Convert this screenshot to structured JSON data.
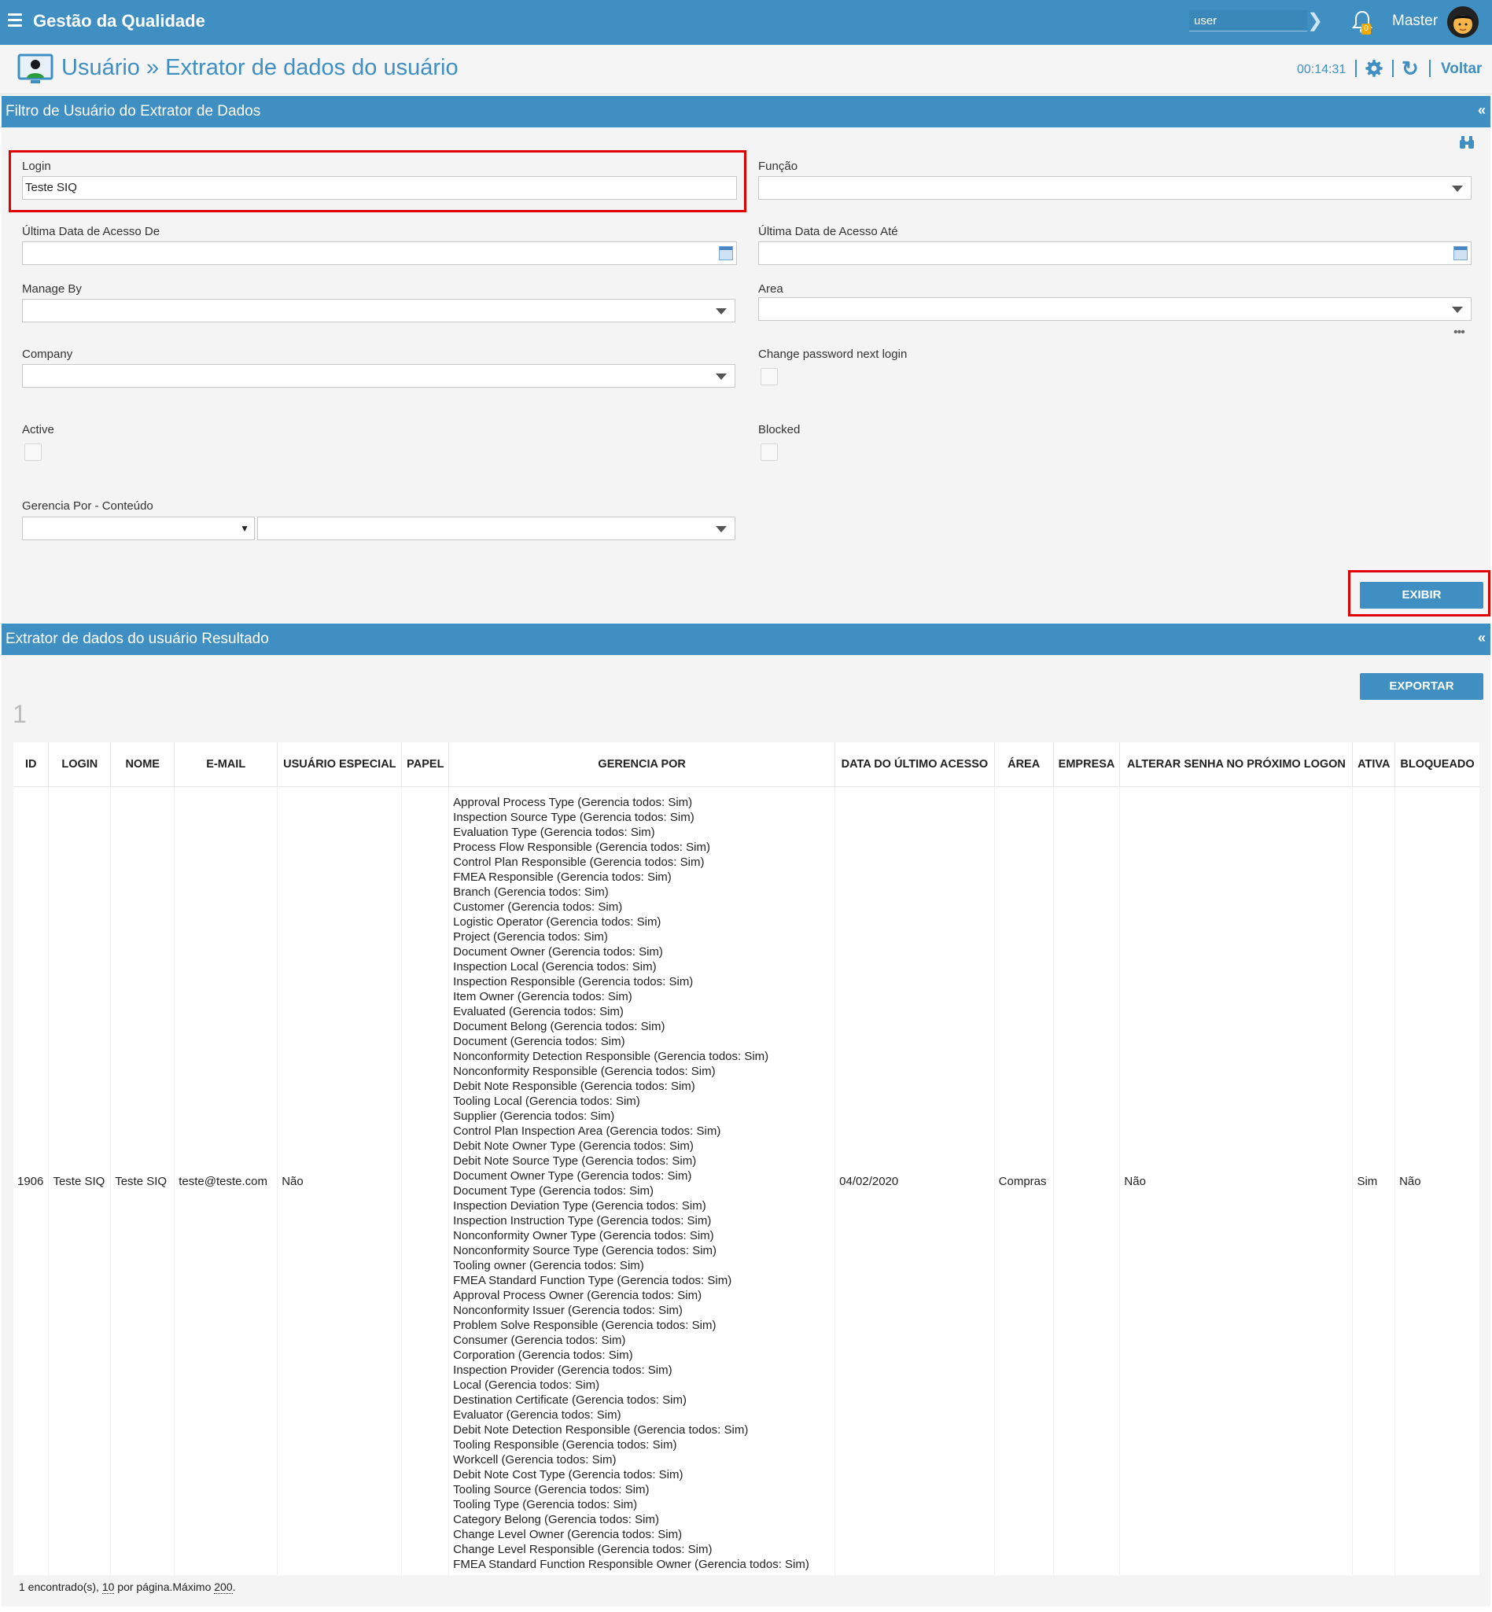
{
  "app": {
    "title": "Gestão da Qualidade"
  },
  "topbar": {
    "search_value": "user",
    "username": "Master",
    "notification_count": "0"
  },
  "breadcrumb": {
    "title": "Usuário » Extrator de dados do usuário",
    "timer": "00:14:31",
    "back_label": "Voltar"
  },
  "filter": {
    "panel_title": "Filtro de Usuário do Extrator de Dados",
    "collapse": "«",
    "login_label": "Login",
    "login_value": "Teste SIQ",
    "funcao_label": "Função",
    "date_from_label": "Última Data de Acesso De",
    "date_to_label": "Última Data de Acesso Até",
    "manage_by_label": "Manage By",
    "area_label": "Area",
    "company_label": "Company",
    "change_password_label": "Change password next login",
    "active_label": "Active",
    "blocked_label": "Blocked",
    "gerencia_label": "Gerencia Por - Conteúdo",
    "show_button": "EXIBIR"
  },
  "results": {
    "panel_title": "Extrator de dados do usuário Resultado",
    "collapse": "«",
    "export_button": "EXPORTAR",
    "page_number": "1",
    "headers": [
      "ID",
      "LOGIN",
      "NOME",
      "E-MAIL",
      "USUÁRIO ESPECIAL",
      "PAPEL",
      "GERENCIA POR",
      "DATA DO ÚLTIMO ACESSO",
      "ÁREA",
      "EMPRESA",
      "ALTERAR SENHA NO PRÓXIMO LOGON",
      "ATIVA",
      "BLOQUEADO"
    ],
    "row": {
      "id": "1906",
      "login": "Teste SIQ",
      "nome": "Teste SIQ",
      "email": "teste@teste.com",
      "especial": "Não",
      "papel": "",
      "data": "04/02/2020",
      "area": "Compras",
      "empresa": "",
      "alterar": "Não",
      "ativa": "Sim",
      "bloqueado": "Não",
      "gerencia": [
        "Approval Process Type (Gerencia todos: Sim)",
        "Inspection Source Type (Gerencia todos: Sim)",
        "Evaluation Type (Gerencia todos: Sim)",
        "Process Flow Responsible (Gerencia todos: Sim)",
        "Control Plan Responsible (Gerencia todos: Sim)",
        "FMEA Responsible (Gerencia todos: Sim)",
        "Branch (Gerencia todos: Sim)",
        "Customer (Gerencia todos: Sim)",
        "Logistic Operator (Gerencia todos: Sim)",
        "Project (Gerencia todos: Sim)",
        "Document Owner (Gerencia todos: Sim)",
        "Inspection Local (Gerencia todos: Sim)",
        "Inspection Responsible (Gerencia todos: Sim)",
        "Item Owner (Gerencia todos: Sim)",
        "Evaluated (Gerencia todos: Sim)",
        "Document Belong (Gerencia todos: Sim)",
        "Document (Gerencia todos: Sim)",
        "Nonconformity Detection Responsible (Gerencia todos: Sim)",
        "Nonconformity Responsible (Gerencia todos: Sim)",
        "Debit Note Responsible (Gerencia todos: Sim)",
        "Tooling Local (Gerencia todos: Sim)",
        "Supplier (Gerencia todos: Sim)",
        "Control Plan Inspection Area (Gerencia todos: Sim)",
        "Debit Note Owner Type (Gerencia todos: Sim)",
        "Debit Note Source Type (Gerencia todos: Sim)",
        "Document Owner Type (Gerencia todos: Sim)",
        "Document Type (Gerencia todos: Sim)",
        "Inspection Deviation Type (Gerencia todos: Sim)",
        "Inspection Instruction Type (Gerencia todos: Sim)",
        "Nonconformity Owner Type (Gerencia todos: Sim)",
        "Nonconformity Source Type (Gerencia todos: Sim)",
        "Tooling owner (Gerencia todos: Sim)",
        "FMEA Standard Function Type (Gerencia todos: Sim)",
        "Approval Process Owner (Gerencia todos: Sim)",
        "Nonconformity Issuer (Gerencia todos: Sim)",
        "Problem Solve Responsible (Gerencia todos: Sim)",
        "Consumer (Gerencia todos: Sim)",
        "Corporation (Gerencia todos: Sim)",
        "Inspection Provider (Gerencia todos: Sim)",
        "Local (Gerencia todos: Sim)",
        "Destination Certificate (Gerencia todos: Sim)",
        "Evaluator (Gerencia todos: Sim)",
        "Debit Note Detection Responsible (Gerencia todos: Sim)",
        "Tooling Responsible (Gerencia todos: Sim)",
        "Workcell (Gerencia todos: Sim)",
        "Debit Note Cost Type (Gerencia todos: Sim)",
        "Tooling Source (Gerencia todos: Sim)",
        "Tooling Type (Gerencia todos: Sim)",
        "Category Belong (Gerencia todos: Sim)",
        "Change Level Owner (Gerencia todos: Sim)",
        "Change Level Responsible (Gerencia todos: Sim)",
        "FMEA Standard Function Responsible Owner (Gerencia todos: Sim)"
      ]
    },
    "footer": {
      "found": "1 encontrado(s), ",
      "per_page": "10",
      "per_page_text": " por página.Máximo ",
      "max": "200",
      "end": "."
    }
  },
  "colors": {
    "accent": "#3f8fc2",
    "highlight": "#e00000"
  }
}
